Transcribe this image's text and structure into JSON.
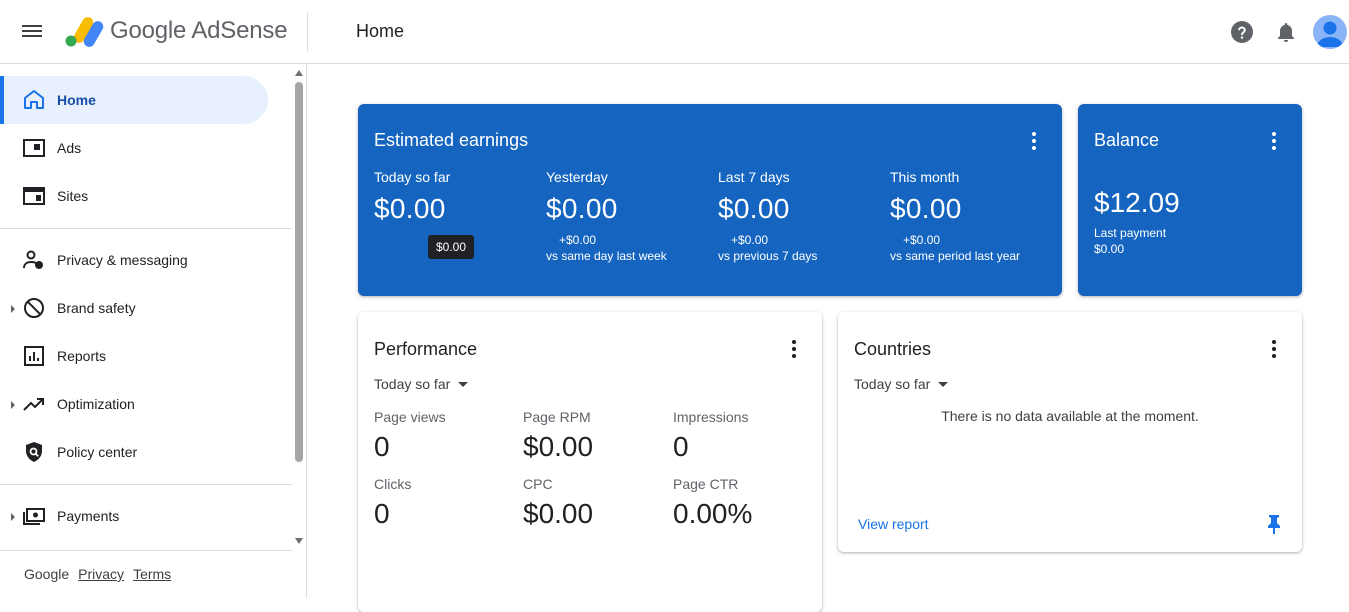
{
  "header": {
    "brand": "Google AdSense",
    "page_title": "Home"
  },
  "sidebar": {
    "items": [
      {
        "label": "Home",
        "icon": "home-icon",
        "active": true
      },
      {
        "label": "Ads",
        "icon": "ads-icon"
      },
      {
        "label": "Sites",
        "icon": "sites-icon"
      },
      {
        "label": "Privacy & messaging",
        "icon": "privacy-icon"
      },
      {
        "label": "Brand safety",
        "icon": "block-icon",
        "expandable": true
      },
      {
        "label": "Reports",
        "icon": "reports-icon"
      },
      {
        "label": "Optimization",
        "icon": "trending-icon",
        "expandable": true
      },
      {
        "label": "Policy center",
        "icon": "policy-shield-icon"
      },
      {
        "label": "Payments",
        "icon": "payments-icon",
        "expandable": true
      }
    ],
    "footer": {
      "google": "Google",
      "privacy": "Privacy",
      "terms": "Terms"
    }
  },
  "earnings": {
    "title": "Estimated earnings",
    "columns": [
      {
        "label": "Today so far",
        "value": "$0.00"
      },
      {
        "label": "Yesterday",
        "value": "$0.00",
        "delta": "+$0.00",
        "compare": "vs same day last week"
      },
      {
        "label": "Last 7 days",
        "value": "$0.00",
        "delta": "+$0.00",
        "compare": "vs previous 7 days"
      },
      {
        "label": "This month",
        "value": "$0.00",
        "delta": "+$0.00",
        "compare": "vs same period last year"
      }
    ],
    "tooltip": "$0.00"
  },
  "balance": {
    "title": "Balance",
    "value": "$12.09",
    "last_payment_label": "Last payment",
    "last_payment_value": "$0.00"
  },
  "performance": {
    "title": "Performance",
    "range": "Today so far",
    "metrics": [
      {
        "label": "Page views",
        "value": "0"
      },
      {
        "label": "Page RPM",
        "value": "$0.00"
      },
      {
        "label": "Impressions",
        "value": "0"
      },
      {
        "label": "Clicks",
        "value": "0"
      },
      {
        "label": "CPC",
        "value": "$0.00"
      },
      {
        "label": "Page CTR",
        "value": "0.00%"
      }
    ]
  },
  "countries": {
    "title": "Countries",
    "range": "Today so far",
    "empty_message": "There is no data available at the moment.",
    "view_report": "View report"
  },
  "colors": {
    "primary_blue": "#1565c0",
    "accent": "#1a73e8",
    "active_bg": "#e8f0fe"
  }
}
